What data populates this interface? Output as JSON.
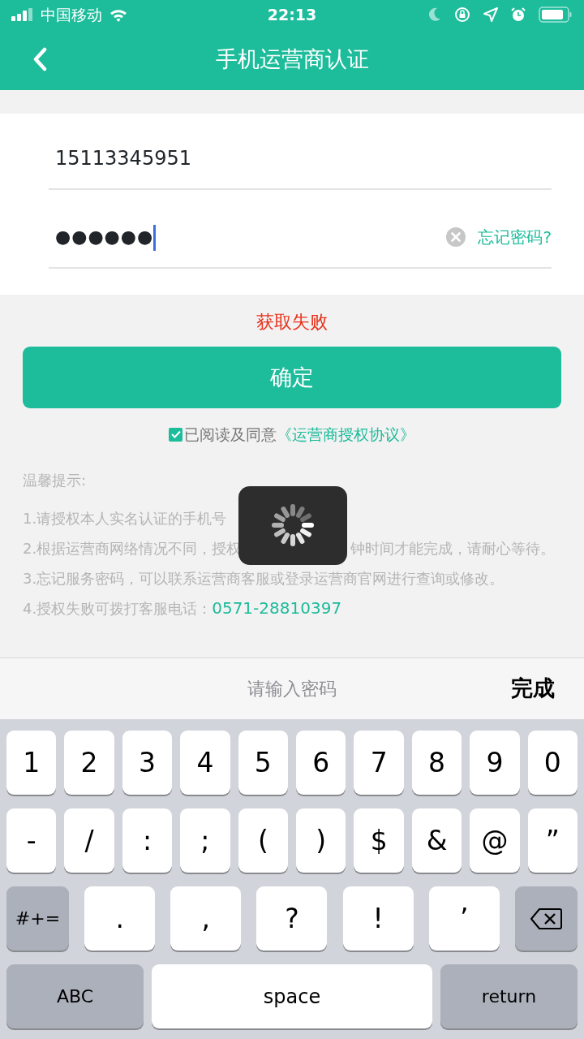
{
  "status_bar": {
    "carrier": "中国移动",
    "time": "22:13"
  },
  "nav": {
    "title": "手机运营商认证"
  },
  "form": {
    "phone": {
      "value": "15113345951"
    },
    "password": {
      "value": "●●●●●●",
      "focused": true
    },
    "forgot_link": "忘记密码?"
  },
  "error": "获取失败",
  "confirm_button": "确定",
  "agreement": {
    "checked": true,
    "text": "已阅读及同意",
    "link": "《运营商授权协议》"
  },
  "tips": {
    "title": "温馨提示:",
    "items": [
      {
        "text": "1.请授权本人实名认证的手机号"
      },
      {
        "text": "2.根据运营商网络情况不同，授权",
        "after": "钟时间才能完成，请耐心等待。"
      },
      {
        "text": "3.忘记服务密码，可以联系运营商客服或登录运营商官网进行查询或修改。"
      },
      {
        "text": "4.授权失败可拨打客服电话：",
        "phone": "0571-28810397"
      }
    ]
  },
  "loading": {
    "visible": true
  },
  "keyboard_toolbar": {
    "placeholder": "请输入密码",
    "done": "完成"
  },
  "keyboard": {
    "rows": [
      {
        "keys": [
          {
            "label": "1",
            "kind": "char"
          },
          {
            "label": "2",
            "kind": "char"
          },
          {
            "label": "3",
            "kind": "char"
          },
          {
            "label": "4",
            "kind": "char"
          },
          {
            "label": "5",
            "kind": "char"
          },
          {
            "label": "6",
            "kind": "char"
          },
          {
            "label": "7",
            "kind": "char"
          },
          {
            "label": "8",
            "kind": "char"
          },
          {
            "label": "9",
            "kind": "char"
          },
          {
            "label": "0",
            "kind": "char"
          }
        ]
      },
      {
        "keys": [
          {
            "label": "-",
            "kind": "char"
          },
          {
            "label": "/",
            "kind": "char"
          },
          {
            "label": ":",
            "kind": "char"
          },
          {
            "label": ";",
            "kind": "char"
          },
          {
            "label": "(",
            "kind": "char"
          },
          {
            "label": ")",
            "kind": "char"
          },
          {
            "label": "$",
            "kind": "char"
          },
          {
            "label": "&",
            "kind": "char"
          },
          {
            "label": "@",
            "kind": "char"
          },
          {
            "label": "”",
            "kind": "char"
          }
        ]
      },
      {
        "keys": [
          {
            "label": "#+=",
            "kind": "mod"
          },
          {
            "label": ".",
            "kind": "wide"
          },
          {
            "label": ",",
            "kind": "wide"
          },
          {
            "label": "?",
            "kind": "wide"
          },
          {
            "label": "!",
            "kind": "wide"
          },
          {
            "label": "’",
            "kind": "wide"
          },
          {
            "kind": "backspace"
          }
        ]
      },
      {
        "keys": [
          {
            "label": "ABC",
            "kind": "mod"
          },
          {
            "label": "space",
            "kind": "space"
          },
          {
            "label": "return",
            "kind": "mod"
          }
        ]
      }
    ]
  }
}
